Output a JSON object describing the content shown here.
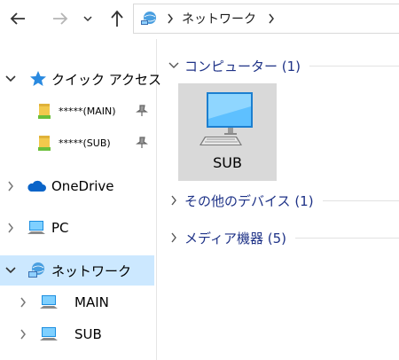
{
  "address_bar": {
    "segments": [
      "ネットワーク"
    ]
  },
  "sidebar": {
    "quick_access": "クイック アクセス",
    "qa_items": [
      "*****(MAIN)",
      "*****(SUB)"
    ],
    "onedrive": "OneDrive",
    "pc": "PC",
    "network": "ネットワーク",
    "network_children": [
      "MAIN",
      "SUB"
    ]
  },
  "main": {
    "groups": [
      {
        "title": "コンピューター (1)",
        "expanded": true
      },
      {
        "title": "その他のデバイス (1)",
        "expanded": false
      },
      {
        "title": "メディア機器 (5)",
        "expanded": false
      }
    ],
    "computer_item": {
      "label": "SUB"
    }
  },
  "colors": {
    "selection": "#cce8ff",
    "group_title": "#1e3287",
    "tile": "#d9d9d9"
  }
}
